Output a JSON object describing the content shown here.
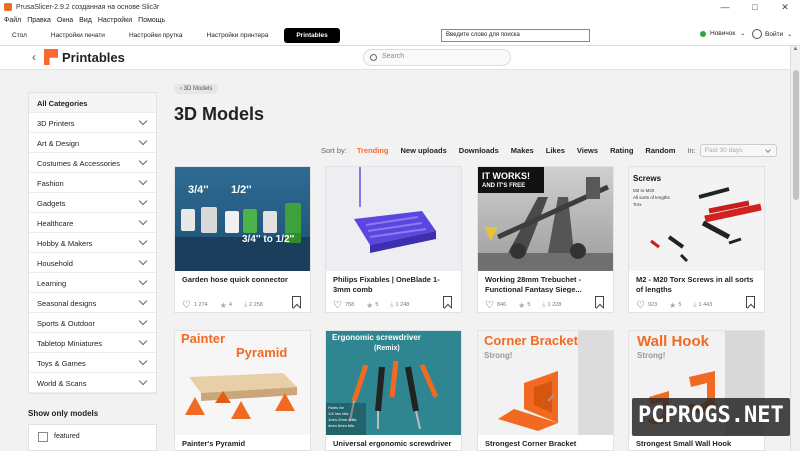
{
  "window": {
    "title": "PrusaSlicer-2.9.2 созданная на основе Slic3r",
    "controls": [
      "—",
      "□",
      "✕"
    ]
  },
  "menu": [
    "Файл",
    "Правка",
    "Окна",
    "Вид",
    "Настройки",
    "Помощь"
  ],
  "tabs": [
    {
      "label": "Стол",
      "active": false
    },
    {
      "label": "Настройки печати",
      "active": false
    },
    {
      "label": "Настройки прутка",
      "active": false
    },
    {
      "label": "Настройки принтера",
      "active": false
    },
    {
      "label": "Printables",
      "active": true
    }
  ],
  "toolbar_search": {
    "value": "Введите слово для поиска"
  },
  "mode": {
    "label": "Новичок",
    "color": "#2aa745"
  },
  "login": {
    "label": "Войти"
  },
  "printables": {
    "brand": "Printables",
    "brand_color": "#fa6831",
    "search_placeholder": "Search"
  },
  "breadcrumb": "3D Models",
  "heading": "3D Models",
  "sidebar": {
    "categories": [
      "All Categories",
      "3D Printers",
      "Art & Design",
      "Costumes & Accessories",
      "Fashion",
      "Gadgets",
      "Healthcare",
      "Hobby & Makers",
      "Household",
      "Learning",
      "Seasonal designs",
      "Sports & Outdoor",
      "Tabletop Miniatures",
      "Toys & Games",
      "World & Scans"
    ],
    "show_only_title": "Show only models",
    "featured_label": "featured"
  },
  "sort": {
    "label": "Sort by:",
    "options": [
      "Trending",
      "New uploads",
      "Downloads",
      "Makes",
      "Likes",
      "Views",
      "Rating",
      "Random"
    ],
    "active": "Trending",
    "in_label": "In:",
    "period": "Past 30 days"
  },
  "models": [
    {
      "name": "Garden hose quick connector",
      "likes": "1 274",
      "rating": "4",
      "downloads": "2 258",
      "image_text": [
        "3/4''",
        "1/2''",
        "3/4'' to 1/2''"
      ]
    },
    {
      "name": "Philips Fixables | OneBlade 1-3mm comb",
      "likes": "758",
      "rating": "5",
      "downloads": "1 248",
      "image_text": []
    },
    {
      "name": "Working 28mm Trebuchet - Functional Fantasy Siege...",
      "likes": "846",
      "rating": "5",
      "downloads": "1 228",
      "image_text": [
        "IT WORKS!",
        "AND IT'S FREE"
      ]
    },
    {
      "name": "M2 - M20 Torx Screws in all sorts of lengths",
      "likes": "923",
      "rating": "5",
      "downloads": "1 443",
      "image_text": [
        "Screws",
        "M2 to M20",
        "All sorts of lengths",
        "Torx"
      ]
    },
    {
      "name": "Painter's Pyramid",
      "image_text": [
        "Painter",
        "Pyramid"
      ]
    },
    {
      "name": "Universal ergonomic screwdriver",
      "image_text": [
        "Ergonomic screwdriver",
        "(Remix)",
        "Holes for",
        "1/4 hex bits",
        "1mm-2mm drills",
        "4mm 6mm bits"
      ]
    },
    {
      "name": "Strongest Corner Bracket",
      "image_text": [
        "Corner Bracket",
        "Strong!"
      ]
    },
    {
      "name": "Strongest Small Wall Hook",
      "image_text": [
        "Wall Hook",
        "Strong!"
      ]
    }
  ],
  "watermark": "PCPROGS.NET"
}
